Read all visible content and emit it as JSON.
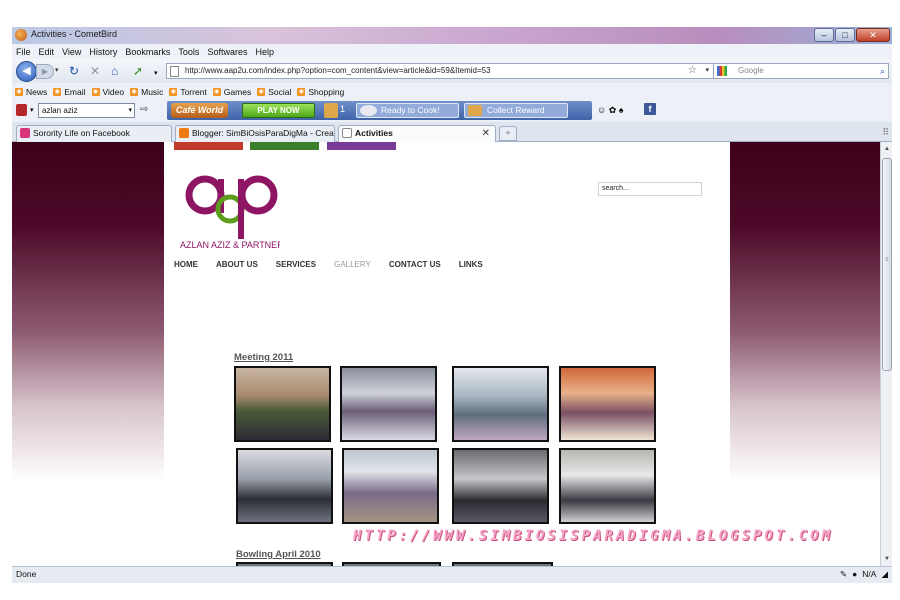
{
  "window": {
    "title": "Activities - CometBird",
    "buttons": {
      "minimize": "‒",
      "maximize": "□",
      "close": "✕"
    }
  },
  "menu": [
    "File",
    "Edit",
    "View",
    "History",
    "Bookmarks",
    "Tools",
    "Softwares",
    "Help"
  ],
  "navbar": {
    "url": "http://www.aap2u.com/index.php?option=com_content&view=article&id=59&Itemid=53",
    "search_placeholder": "Google"
  },
  "bookmarks": [
    "News",
    "Email",
    "Video",
    "Music",
    "Torrent",
    "Games",
    "Social",
    "Shopping"
  ],
  "toolbar": {
    "search_value": "azlan aziz",
    "cafe_logo": "Café World",
    "play_now": "PLAY NOW",
    "gift_count": "1",
    "ready": "Ready to Cook!",
    "collect": "Collect Reward",
    "facebook": "f"
  },
  "tabs": [
    {
      "label": "Sorority Life on Facebook",
      "active": false
    },
    {
      "label": "Blogger: SimBiOsisParaDigMa - Create ...",
      "active": false
    },
    {
      "label": "Activities",
      "active": true
    }
  ],
  "site": {
    "logo_letters": "aap",
    "logo_text": "AZLAN AZIZ & PARTNERS",
    "search_value": "search...",
    "nav": [
      "HOME",
      "ABOUT US",
      "SERVICES",
      "GALLERY",
      "CONTACT US",
      "LINKS"
    ],
    "top_colors": [
      "#c0392b",
      "#3a7d2a",
      "#7b3c98"
    ],
    "section1": "Meeting 2011",
    "section2": "Bowling April 2010"
  },
  "status": {
    "left": "Done",
    "right": "N/A"
  },
  "watermark": "HTTP://WWW.SIMBIOSISPARADIGMA.BLOGSPOT.COM",
  "colors": {
    "brand_purple": "#8e1464",
    "brand_green": "#5d9c1d",
    "bg_maroon": "#3d0019"
  }
}
